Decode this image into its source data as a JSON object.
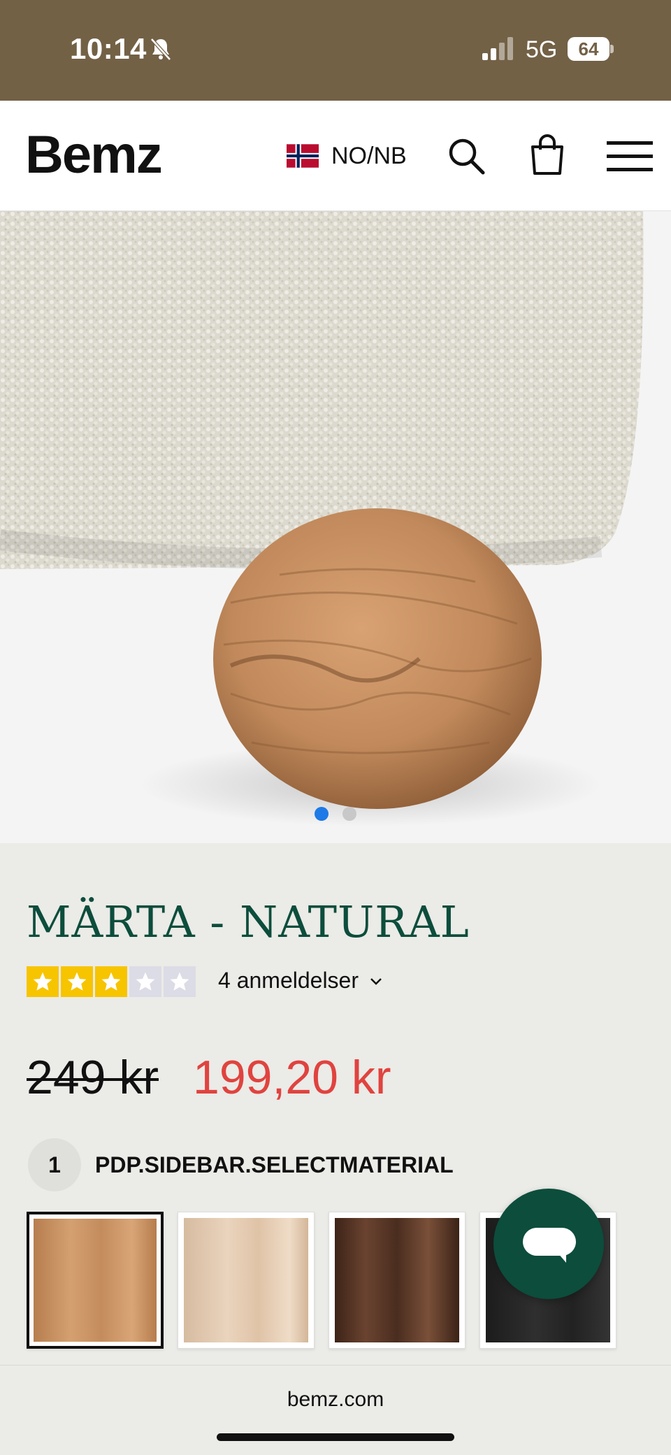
{
  "status_bar": {
    "time": "10:14",
    "network": "5G",
    "battery": "64",
    "icons": [
      "bell-slash-icon",
      "signal-icon",
      "battery-icon"
    ]
  },
  "header": {
    "logo": "Bemz",
    "locale": "NO/NB",
    "icons": [
      "norway-flag-icon",
      "search-icon",
      "shopping-bag-icon",
      "menu-icon"
    ]
  },
  "gallery": {
    "slides": 2,
    "active_slide": 1,
    "active_dot_color": "#1e7ae6",
    "inactive_dot_color": "#c8c8c8"
  },
  "product": {
    "title": "MÄRTA - NATURAL",
    "rating": 3,
    "rating_max": 5,
    "reviews_label": "4 anmeldelser",
    "price_old": "249 kr",
    "price_new": "199,20 kr",
    "title_color": "#0c4d3c",
    "sale_color": "#e0433f"
  },
  "material_step": {
    "number": "1",
    "label": "PDP.SIDEBAR.SELECTMATERIAL",
    "swatches": [
      {
        "name": "natural-oak",
        "selected": true
      },
      {
        "name": "light-beech",
        "selected": false
      },
      {
        "name": "dark-walnut",
        "selected": false
      },
      {
        "name": "black",
        "selected": false
      }
    ]
  },
  "chat": {
    "icon": "chat-bubble-icon"
  },
  "browser": {
    "url": "bemz.com"
  }
}
